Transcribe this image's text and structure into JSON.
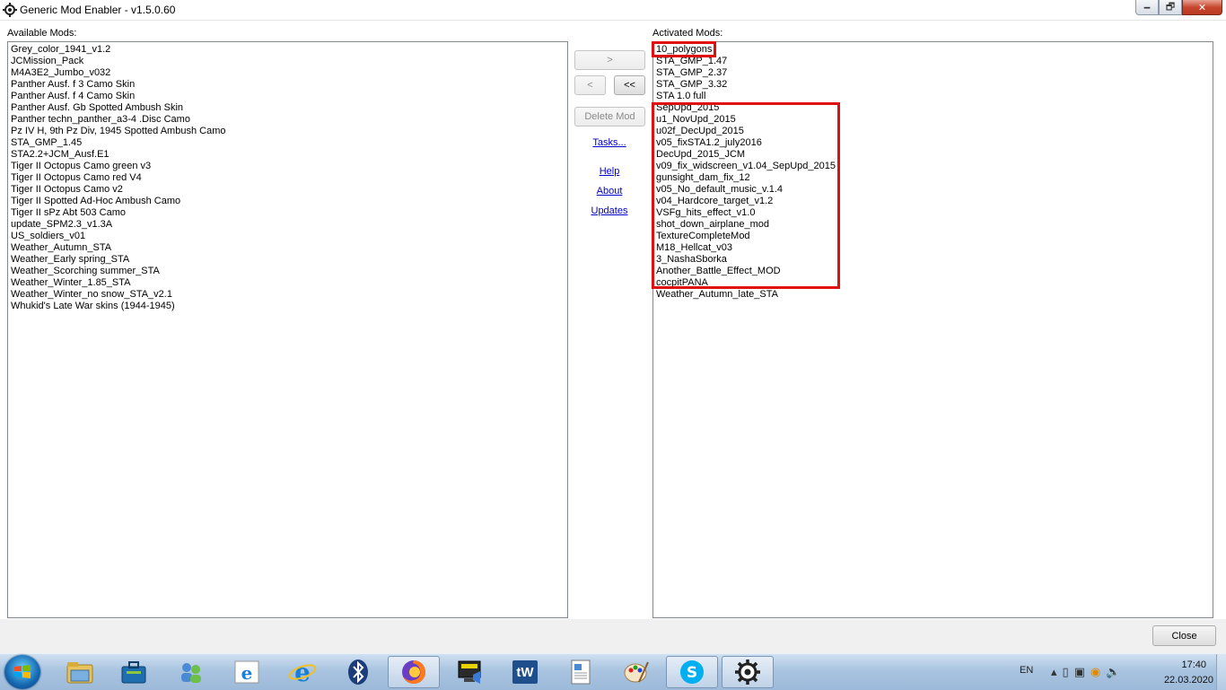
{
  "window": {
    "title": "Generic Mod Enabler - v1.5.0.60",
    "minimize_icon": "minimize-icon",
    "maximize_icon": "restore-icon",
    "close_icon": "close-icon",
    "minimize_glyph": "🗕",
    "maximize_glyph": "🗗",
    "close_glyph": "✕"
  },
  "available": {
    "label": "Available Mods:",
    "items": [
      "Grey_color_1941_v1.2",
      "JCMission_Pack",
      "M4A3E2_Jumbo_v032",
      "Panther Ausf. f 3 Camo Skin",
      "Panther Ausf. f 4 Camo Skin",
      "Panther Ausf. Gb Spotted Ambush Skin",
      "Panther techn_panther_a3-4 .Disc Camo",
      "Pz IV H, 9th Pz Div, 1945 Spotted Ambush Camo",
      "STA_GMP_1.45",
      "STA2.2+JCM_Ausf.E1",
      "Tiger II Octopus Camo green v3",
      "Tiger II Octopus Camo red V4",
      "Tiger II Octopus Camo v2",
      "Tiger II Spotted Ad-Hoc Ambush Camo",
      "Tiger II sPz Abt 503 Camo",
      "update_SPM2.3_v1.3A",
      "US_soldiers_v01",
      "Weather_Autumn_STA",
      "Weather_Early spring_STA",
      "Weather_Scorching summer_STA",
      "Weather_Winter_1.85_STA",
      "Weather_Winter_no snow_STA_v2.1",
      "Whukid's Late War skins (1944-1945)"
    ]
  },
  "activated": {
    "label": "Activated Mods:",
    "items": [
      "10_polygons",
      "STA_GMP_1.47",
      "STA_GMP_2.37",
      "STA_GMP_3.32",
      "STA 1.0 full",
      "SepUpd_2015",
      "u1_NovUpd_2015",
      "u02f_DecUpd_2015",
      "v05_fixSTA1.2_july2016",
      "DecUpd_2015_JCM",
      "v09_fix_widscreen_v1.04_SepUpd_2015",
      "gunsight_dam_fix_12",
      "v05_No_default_music_v.1.4",
      "v04_Hardcore_target_v1.2",
      "VSFg_hits_effect_v1.0",
      "shot_down_airplane_mod",
      "TextureCompleteMod",
      "M18_Hellcat_v03",
      "3_NashaSborka",
      "Another_Battle_Effect_MOD",
      "cocpitPANA",
      "Weather_Autumn_late_STA"
    ]
  },
  "controls": {
    "activate": ">",
    "deactivate": "<",
    "deactivate_all": "<<",
    "delete": "Delete Mod",
    "tasks": "Tasks...",
    "help": "Help",
    "about": "About",
    "updates": "Updates",
    "close": "Close"
  },
  "highlight_color": "#e01010",
  "taskbar": {
    "icons": [
      "start-orb-icon",
      "file-explorer-icon",
      "toolbox-icon",
      "network-users-icon",
      "internet-explorer-icon",
      "internet-explorer-icon",
      "bluetooth-icon",
      "firefox-icon",
      "media-player-icon",
      "tw-app-icon",
      "document-icon",
      "paint-icon",
      "skype-icon",
      "settings-gear-icon"
    ],
    "tw_label": "tW",
    "language": "EN",
    "time": "17:40",
    "date": "22.03.2020"
  }
}
